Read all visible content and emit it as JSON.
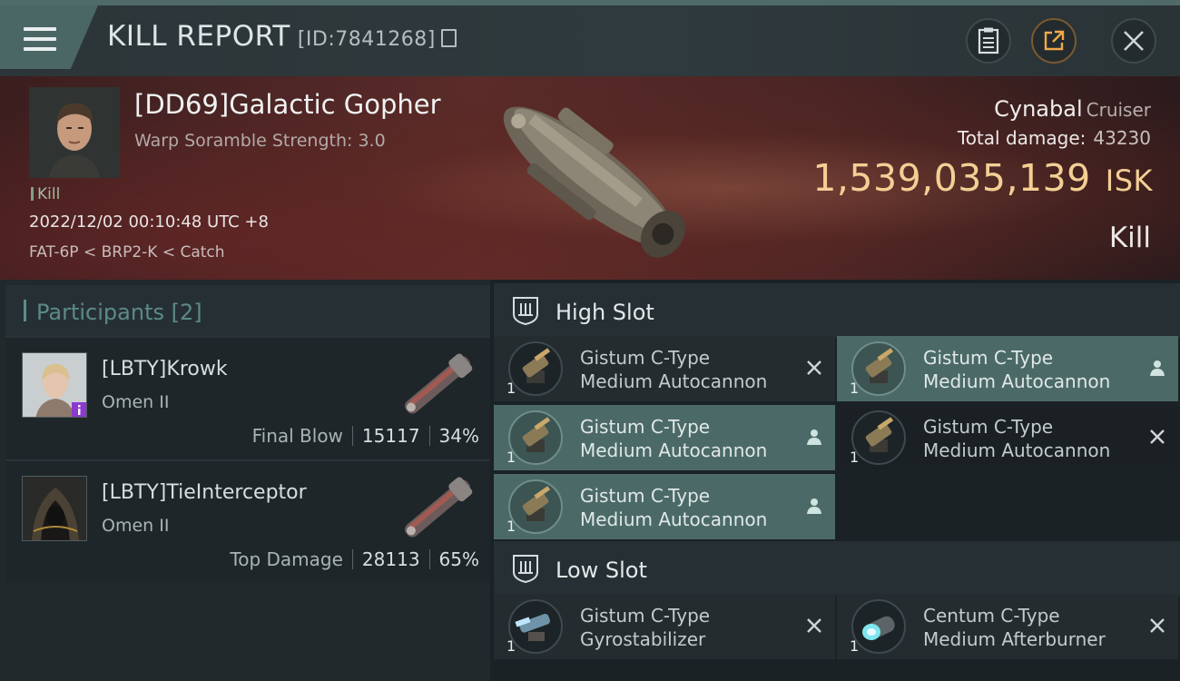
{
  "header": {
    "title": "KILL REPORT",
    "report_id": "[ID:7841268]",
    "icons": [
      "menu-icon",
      "copy-icon",
      "clipboard-icon",
      "share-icon",
      "close-icon"
    ]
  },
  "victim": {
    "name": "[DD69]Galactic Gopher",
    "scramble": "Warp Soramble Strength: 3.0",
    "tag": "Kill",
    "datetime": "2022/12/02 00:10:48 UTC +8",
    "location": "FAT-6P < BRP2-K < Catch",
    "ship_name": "Cynabal",
    "ship_class": "Cruiser",
    "damage_label": "Total damage:",
    "damage_value": "43230",
    "isk_value": "1,539,035,139",
    "isk_unit": "ISK",
    "result": "Kill"
  },
  "participants": {
    "title": "Participants",
    "count": "[2]",
    "items": [
      {
        "name": "[LBTY]Krowk",
        "ship": "Omen II",
        "role": "Final Blow",
        "damage": "15117",
        "percent": "34%"
      },
      {
        "name": "[LBTY]TieInterceptor",
        "ship": "Omen II",
        "role": "Top Damage",
        "damage": "28113",
        "percent": "65%"
      }
    ]
  },
  "slots": {
    "high": {
      "title": "High Slot",
      "modules": [
        {
          "line1": "Gistum C-Type",
          "line2": "Medium Autocannon",
          "qty": "1",
          "state": "destroyed"
        },
        {
          "line1": "Gistum C-Type",
          "line2": "Medium Autocannon",
          "qty": "1",
          "state": "dropped"
        },
        {
          "line1": "Gistum C-Type",
          "line2": "Medium Autocannon",
          "qty": "1",
          "state": "dropped"
        },
        {
          "line1": "Gistum C-Type",
          "line2": "Medium Autocannon",
          "qty": "1",
          "state": "destroyed"
        },
        {
          "line1": "Gistum C-Type",
          "line2": "Medium Autocannon",
          "qty": "1",
          "state": "dropped"
        }
      ]
    },
    "low": {
      "title": "Low Slot",
      "modules": [
        {
          "line1": "Gistum C-Type",
          "line2": "Gyrostabilizer",
          "qty": "1",
          "state": "destroyed"
        },
        {
          "line1": "Centum C-Type",
          "line2": "Medium Afterburner",
          "qty": "1",
          "state": "destroyed"
        }
      ]
    }
  },
  "colors": {
    "accent": "#4b6a67",
    "isk": "#f3cf94",
    "panel": "#242c30"
  }
}
